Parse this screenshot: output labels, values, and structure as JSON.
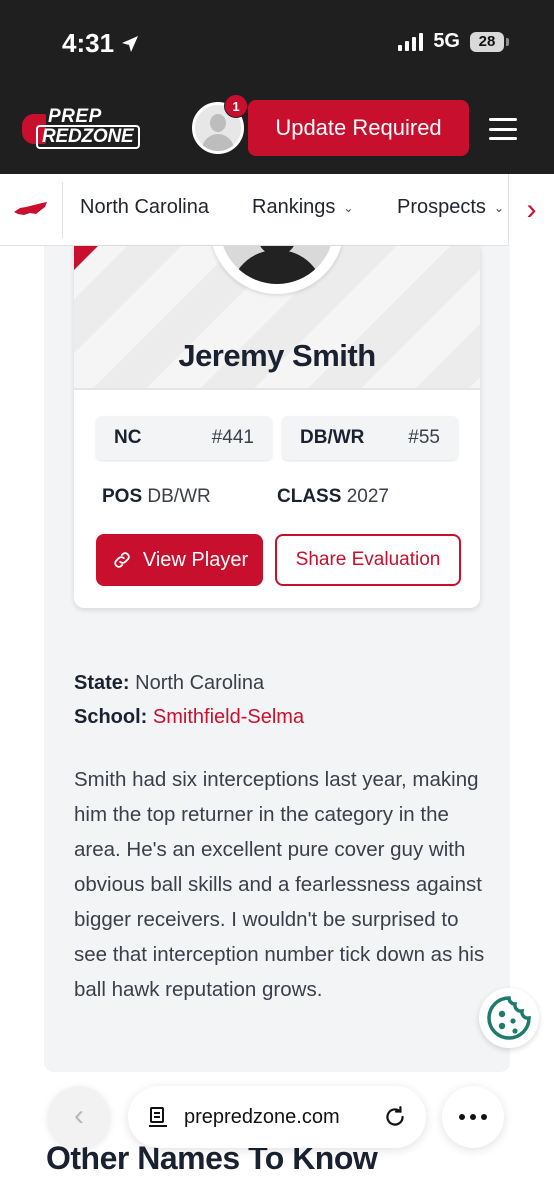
{
  "status_bar": {
    "time": "4:31",
    "network": "5G",
    "battery": "28"
  },
  "header": {
    "logo_line1": "PREP",
    "logo_line2": "REDZONE",
    "notification_count": "1",
    "update_label": "Update Required"
  },
  "subnav": {
    "state": "North Carolina",
    "items": [
      "Rankings",
      "Prospects"
    ]
  },
  "player": {
    "name": "Jeremy Smith",
    "state_code": "NC",
    "state_rank": "#441",
    "position_label": "DB/WR",
    "position_rank": "#55",
    "pos_key": "POS",
    "pos_value": "DB/WR",
    "class_key": "CLASS",
    "class_value": "2027",
    "view_label": "View Player",
    "share_label": "Share Evaluation"
  },
  "details": {
    "state_label": "State:",
    "state_value": "North Carolina",
    "school_label": "School:",
    "school_value": "Smithfield-Selma"
  },
  "evaluation": "Smith had six interceptions last year, making him the top returner in the category in the area. He's an excellent pure cover guy with obvious ball skills and a fearlessness against bigger receivers. I wouldn't be surprised to see that interception number tick down as his ball hawk reputation grows.",
  "next_section_title": "Other Names To Know",
  "browser": {
    "url": "prepredzone.com"
  },
  "colors": {
    "brand_red": "#c8102e",
    "dark_header": "#1f1f1f"
  }
}
